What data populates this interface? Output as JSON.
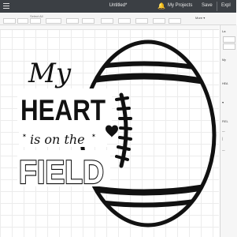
{
  "app": {
    "title": "Untitled*",
    "my_projects": "My Projects",
    "save": "Save",
    "explore_truncated": "Expl"
  },
  "toolbar": {
    "select_all": "Select All",
    "more": "More ▾"
  },
  "panel": {
    "header": "La",
    "layers": [
      "My",
      "HEA",
      "♥",
      "FIEL",
      "—",
      "│",
      "—"
    ]
  },
  "design": {
    "word_my": "My",
    "word_heart": "HEART",
    "word_is_on_the": "is on the",
    "word_field": "FIELD"
  },
  "colors": {
    "topbar": "#3b3f44",
    "ink": "#111111"
  }
}
